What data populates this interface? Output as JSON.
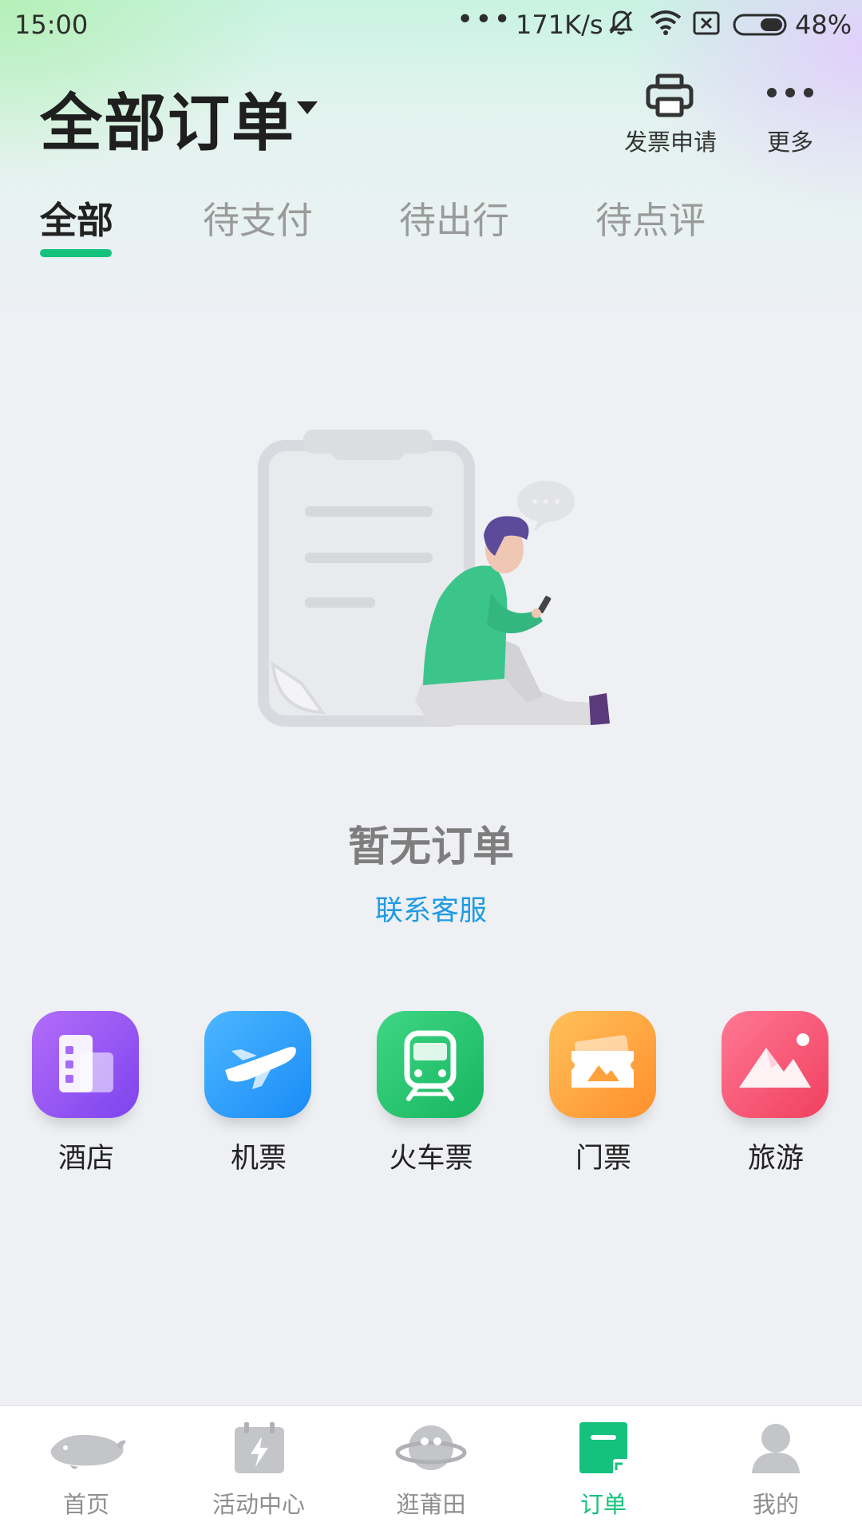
{
  "status_bar": {
    "time": "15:00",
    "dots": "•••",
    "net_speed": "171K/s",
    "battery_pct": "48%",
    "battery_level": 0.48
  },
  "header": {
    "title": "全部订单",
    "invoice_label": "发票申请",
    "more_label": "更多"
  },
  "tabs": [
    {
      "label": "全部",
      "active": true
    },
    {
      "label": "待支付",
      "active": false
    },
    {
      "label": "待出行",
      "active": false
    },
    {
      "label": "待点评",
      "active": false
    }
  ],
  "empty_state": {
    "title": "暂无订单",
    "contact_link": "联系客服"
  },
  "categories": [
    {
      "label": "酒店",
      "icon": "hotel-icon",
      "color": "#8a4ff0"
    },
    {
      "label": "机票",
      "icon": "plane-icon",
      "color": "#1a8cf8"
    },
    {
      "label": "火车票",
      "icon": "train-icon",
      "color": "#22c36f"
    },
    {
      "label": "门票",
      "icon": "ticket-icon",
      "color": "#ff9a2e"
    },
    {
      "label": "旅游",
      "icon": "travel-icon",
      "color": "#f24d6b"
    }
  ],
  "bottom_nav": [
    {
      "label": "首页",
      "icon": "whale-icon",
      "active": false
    },
    {
      "label": "活动中心",
      "icon": "calendar-bolt-icon",
      "active": false
    },
    {
      "label": "逛莆田",
      "icon": "planet-icon",
      "active": false
    },
    {
      "label": "订单",
      "icon": "order-icon",
      "active": true
    },
    {
      "label": "我的",
      "icon": "person-icon",
      "active": false
    }
  ],
  "colors": {
    "accent": "#15c27d",
    "link": "#1e9be3"
  }
}
